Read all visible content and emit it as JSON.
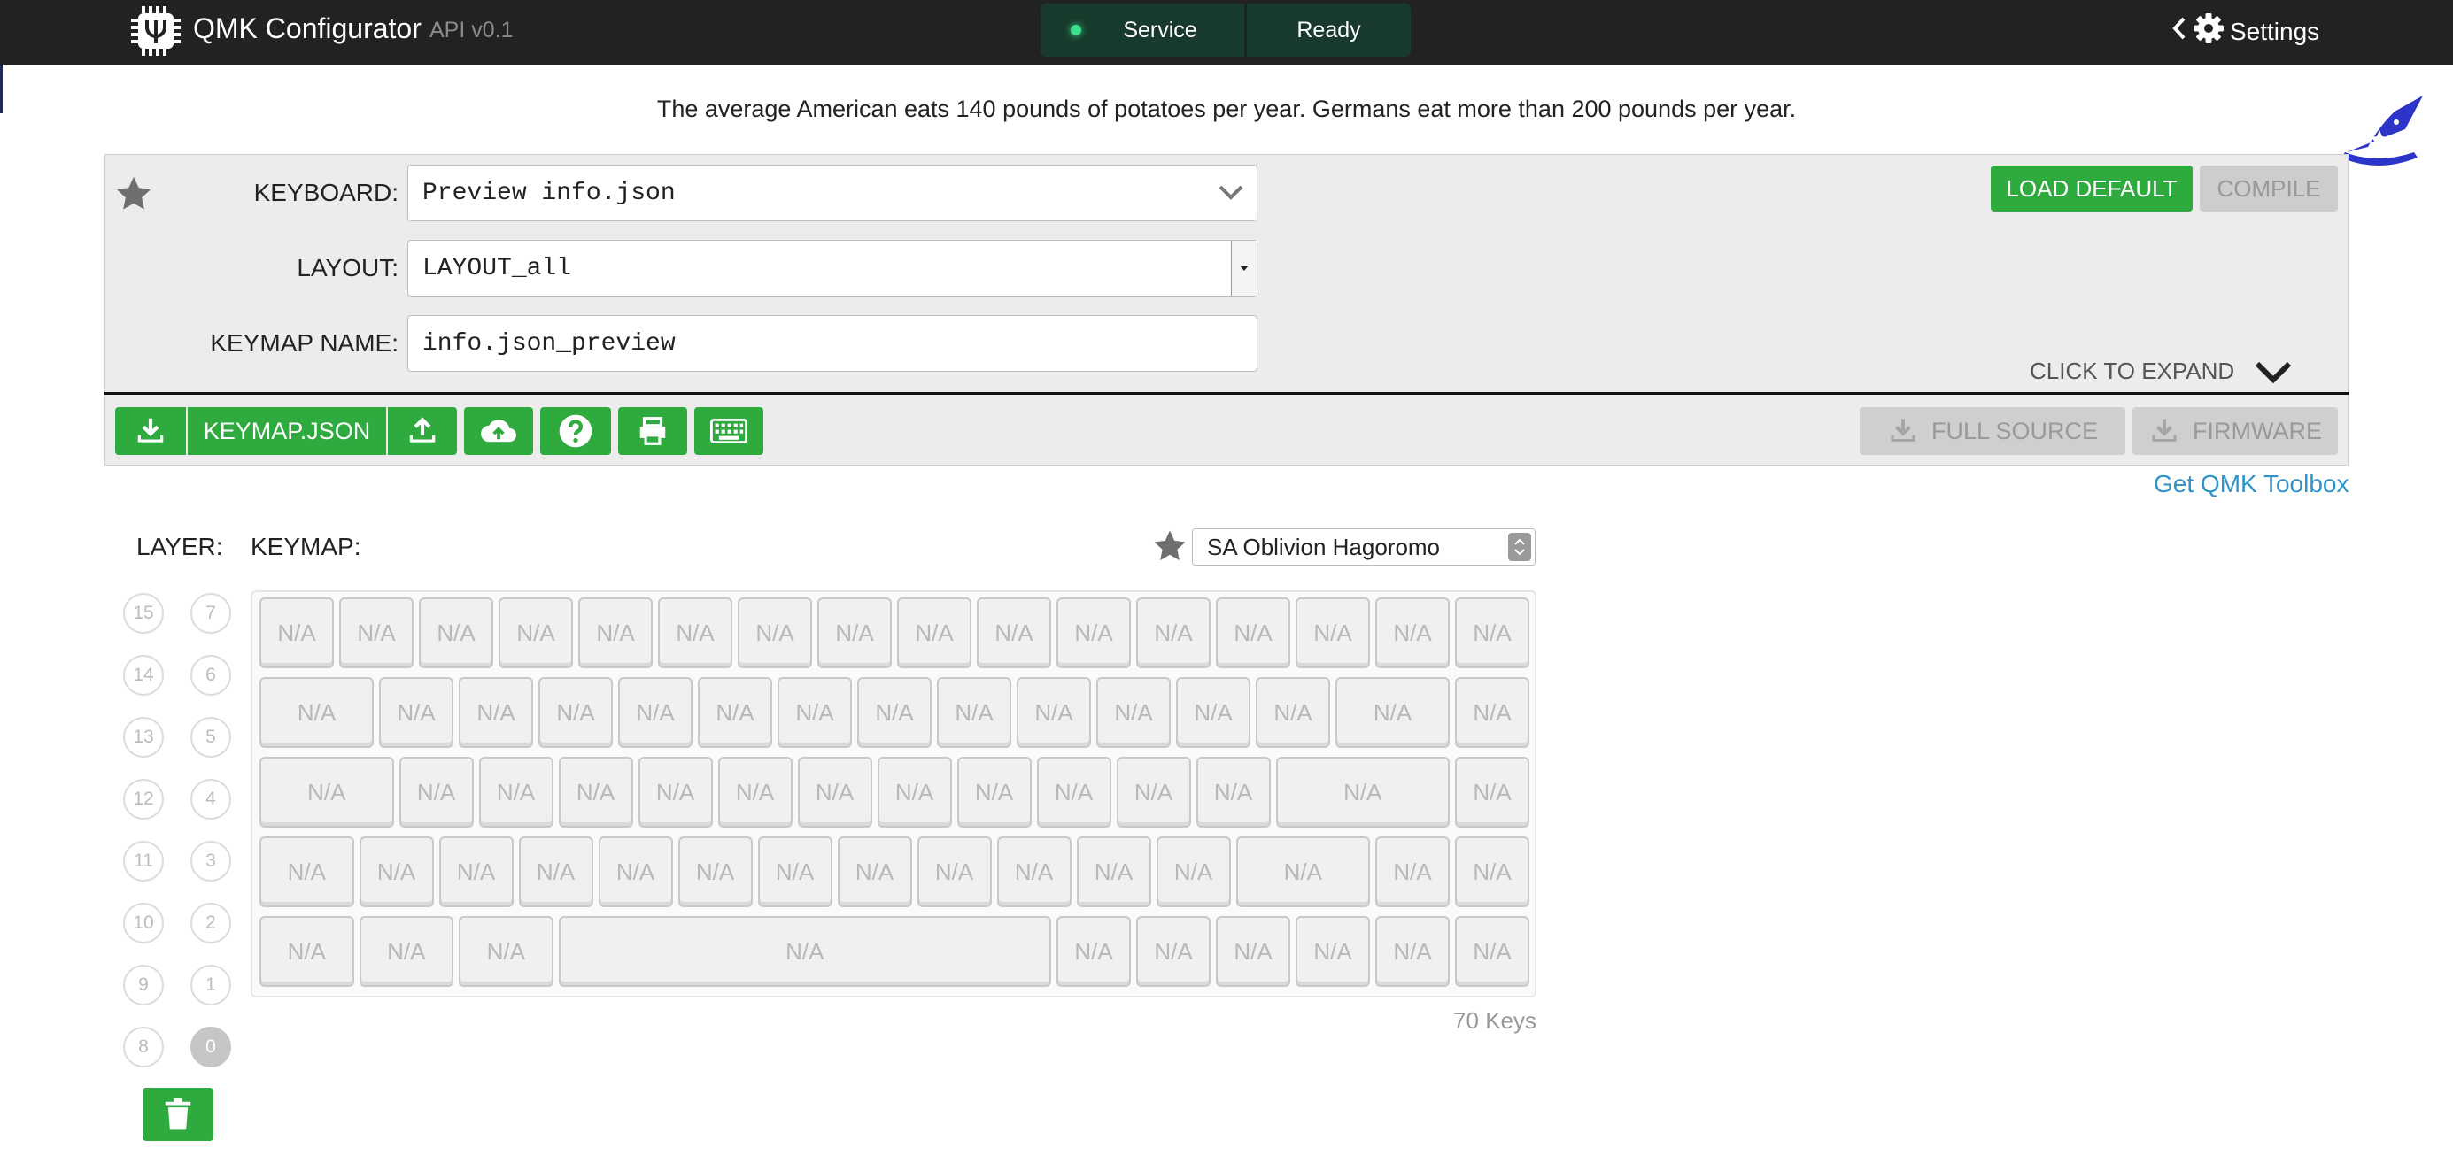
{
  "app": {
    "title": "QMK Configurator",
    "api_version": "API v0.1",
    "status": {
      "service_label": "Service",
      "state_label": "Ready"
    },
    "settings_label": "Settings"
  },
  "banner": {
    "fact": "The average American eats 140 pounds of potatoes per year. Germans eat more than 200 pounds per year."
  },
  "form": {
    "keyboard_label": "KEYBOARD:",
    "keyboard_value": "Preview info.json",
    "layout_label": "LAYOUT:",
    "layout_value": "LAYOUT_all",
    "keymap_name_label": "KEYMAP NAME:",
    "keymap_name_value": "info.json_preview"
  },
  "actions": {
    "load_default": "LOAD DEFAULT",
    "compile": "COMPILE",
    "click_to_expand": "CLICK TO EXPAND",
    "keymap_json": "KEYMAP.JSON",
    "full_source": "FULL SOURCE",
    "firmware": "FIRMWARE",
    "toolbox_link": "Get QMK Toolbox",
    "toolbar_icons": [
      "download-icon",
      "upload-icon",
      "cloud-upload-icon",
      "help-icon",
      "print-icon",
      "keyboard-icon"
    ]
  },
  "keymap": {
    "layer_label": "LAYER:",
    "keymap_label": "KEYMAP:",
    "keycap_theme": "SA Oblivion Hagoromo",
    "layers_left": [
      "15",
      "14",
      "13",
      "12",
      "11",
      "10",
      "9",
      "8"
    ],
    "layers_right": [
      "7",
      "6",
      "5",
      "4",
      "3",
      "2",
      "1",
      "0"
    ],
    "active_layer": "0",
    "key_label": "N/A",
    "key_count": "70 Keys",
    "rows": [
      [
        1,
        1,
        1,
        1,
        1,
        1,
        1,
        1,
        1,
        1,
        1,
        1,
        1,
        1,
        1,
        1
      ],
      [
        1.5,
        1,
        1,
        1,
        1,
        1,
        1,
        1,
        1,
        1,
        1,
        1,
        1,
        1.5,
        1
      ],
      [
        1.75,
        1,
        1,
        1,
        1,
        1,
        1,
        1,
        1,
        1,
        1,
        1,
        2.25,
        1
      ],
      [
        1.25,
        1,
        1,
        1,
        1,
        1,
        1,
        1,
        1,
        1,
        1,
        1,
        1.75,
        1,
        1
      ],
      [
        1.25,
        1.25,
        1.25,
        6.25,
        1,
        1,
        1,
        1,
        1,
        1
      ]
    ]
  },
  "colors": {
    "topbar": "#222222",
    "accent_green": "#2eaa3f",
    "status_bg": "#173a2c",
    "link_blue": "#2f93c8",
    "wizard_blue": "#2d35c9"
  }
}
